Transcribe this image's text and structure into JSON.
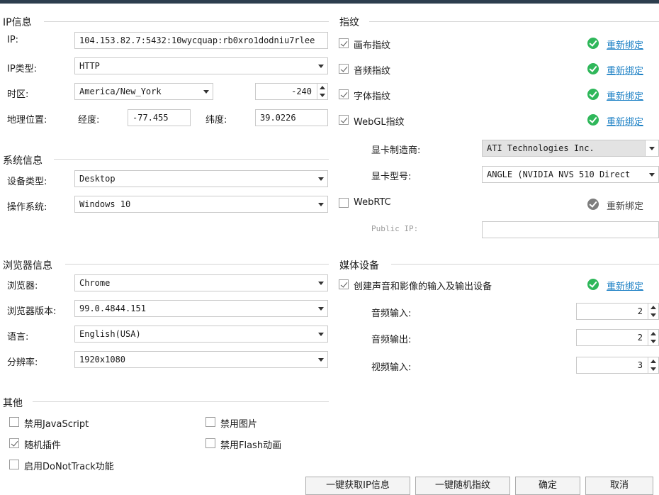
{
  "ip_section": {
    "title": "IP信息",
    "ip_label": "IP:",
    "ip_value": "104.153.82.7:5432:10wycquap:rb0xro1dodniu7rlee",
    "ip_type_label": "IP类型:",
    "ip_type_value": "HTTP",
    "timezone_label": "时区:",
    "timezone_value": "America/New_York",
    "timezone_offset": "-240",
    "geo_label": "地理位置:",
    "longitude_label": "经度:",
    "longitude_value": "-77.455",
    "latitude_label": "纬度:",
    "latitude_value": "39.0226"
  },
  "system_section": {
    "title": "系统信息",
    "device_label": "设备类型:",
    "device_value": "Desktop",
    "os_label": "操作系统:",
    "os_value": "Windows 10"
  },
  "browser_section": {
    "title": "浏览器信息",
    "browser_label": "浏览器:",
    "browser_value": "Chrome",
    "version_label": "浏览器版本:",
    "version_value": "99.0.4844.151",
    "lang_label": "语言:",
    "lang_value": "English(USA)",
    "res_label": "分辨率:",
    "res_value": "1920x1080"
  },
  "other_section": {
    "title": "其他",
    "disable_js": "禁用JavaScript",
    "disable_images": "禁用图片",
    "random_plugins": "随机插件",
    "disable_flash": "禁用Flash动画",
    "enable_dnt": "启用DoNotTrack功能"
  },
  "fingerprint_section": {
    "title": "指纹",
    "canvas": "画布指纹",
    "audio": "音频指纹",
    "font": "字体指纹",
    "webgl": "WebGL指纹",
    "rebind": "重新绑定",
    "gpu_vendor_label": "显卡制造商:",
    "gpu_vendor_value": "ATI Technologies Inc.",
    "gpu_model_label": "显卡型号:",
    "gpu_model_value": "ANGLE (NVIDIA NVS 510 Direct",
    "webrtc": "WebRTC",
    "public_ip_label": "Public IP:",
    "public_ip_value": ""
  },
  "media_section": {
    "title": "媒体设备",
    "create_devices": "创建声音和影像的输入及输出设备",
    "audio_in_label": "音频输入:",
    "audio_in_value": "2",
    "audio_out_label": "音频输出:",
    "audio_out_value": "2",
    "video_in_label": "视频输入:",
    "video_in_value": "3"
  },
  "buttons": {
    "get_ip": "一键获取IP信息",
    "random_fp": "一键随机指纹",
    "confirm": "确定",
    "cancel": "取消"
  },
  "colors": {
    "success": "#2fb75a",
    "link": "#1a7fc4",
    "topbar": "#2d3e4e"
  }
}
